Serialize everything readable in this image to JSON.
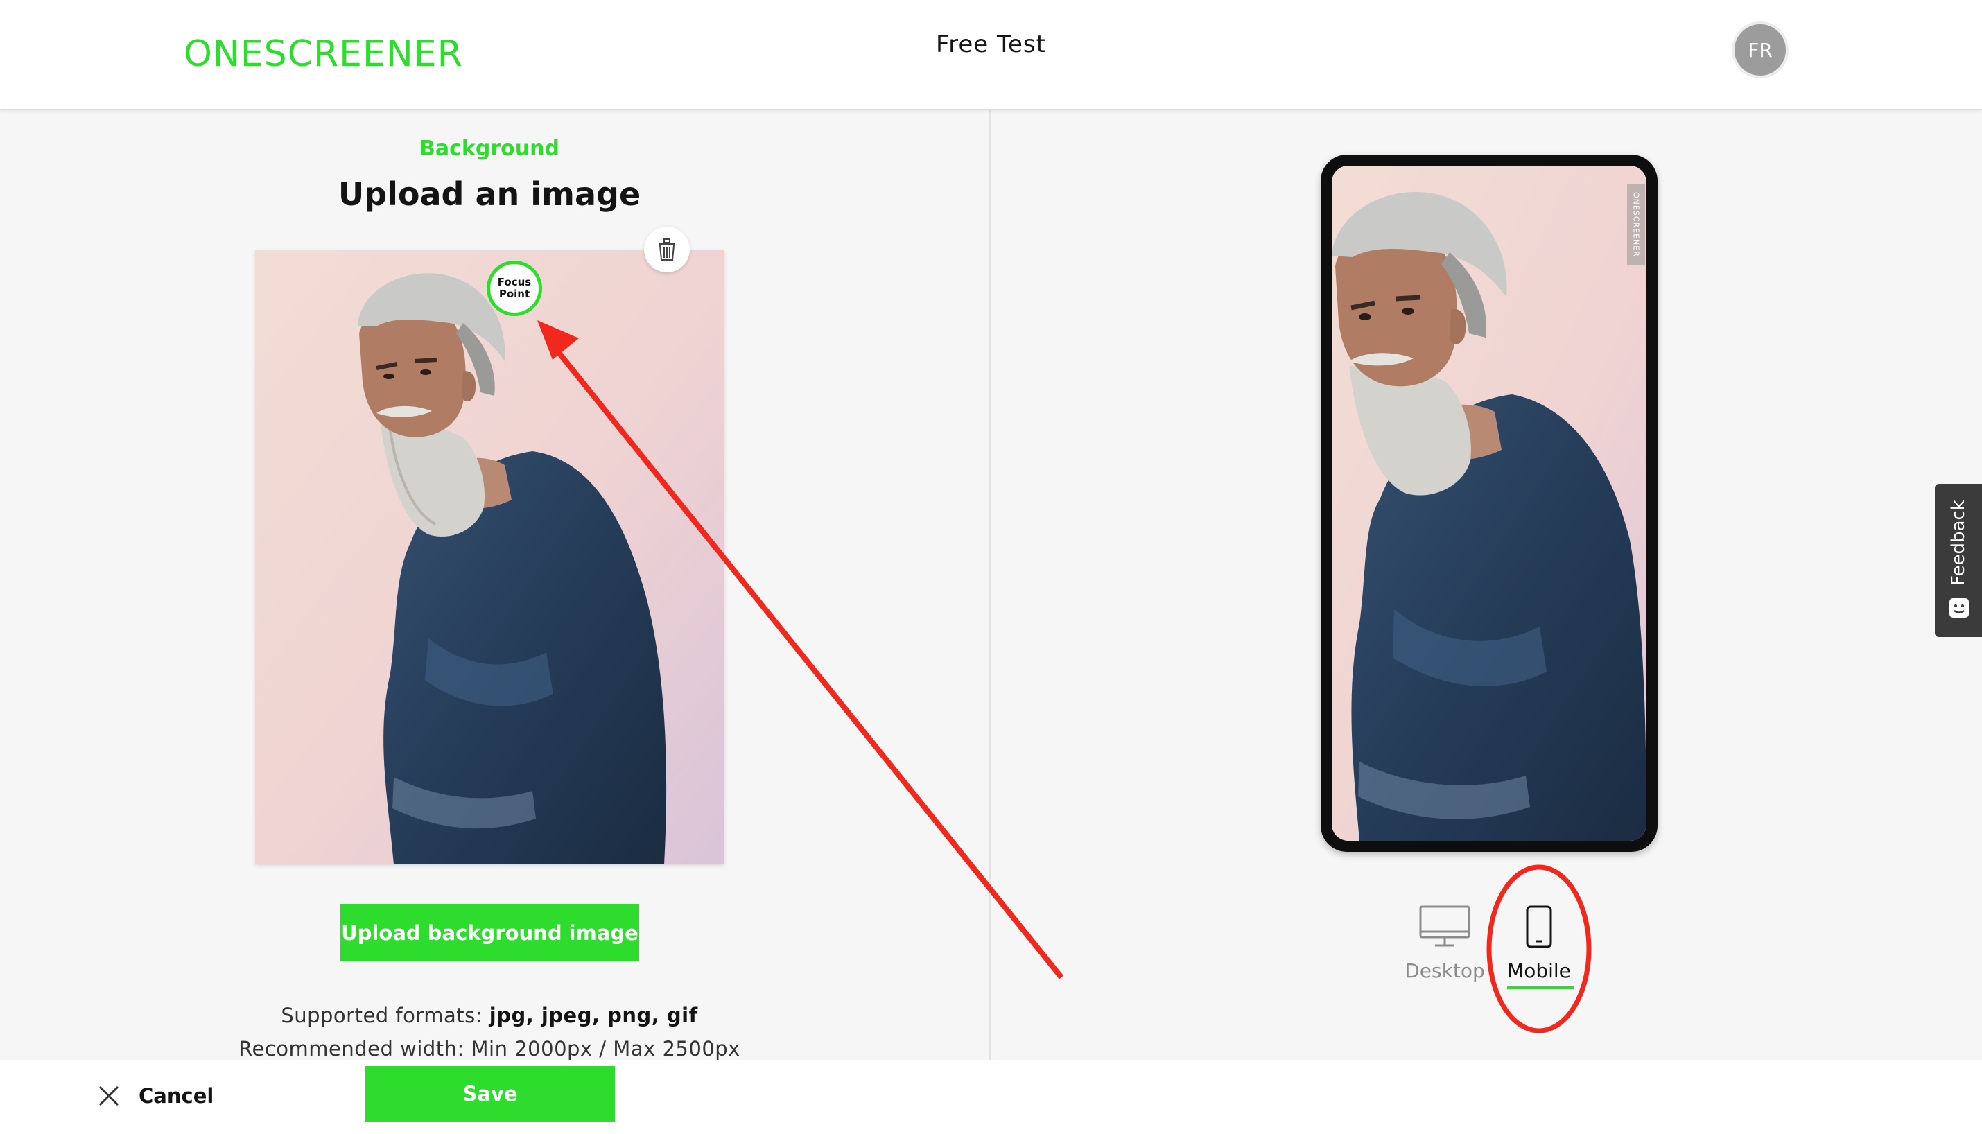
{
  "header": {
    "logo": "ONESCREENER",
    "project_title": "Free Test",
    "avatar_initials": "FR"
  },
  "editor": {
    "section_label": "Background",
    "section_title": "Upload an image",
    "focus_point_label_line1": "Focus",
    "focus_point_label_line2": "Point",
    "upload_button_label": "Upload background image",
    "formats_prefix": "Supported formats: ",
    "formats_value": "jpg, jpeg, png, gif",
    "recommended_width": "Recommended width: Min 2000px / Max 2500px"
  },
  "preview": {
    "watermark": "ONESCREENER",
    "devices": [
      {
        "label": "Desktop",
        "icon": "desktop-icon",
        "selected": false
      },
      {
        "label": "Mobile",
        "icon": "mobile-phone-icon",
        "selected": true
      }
    ]
  },
  "footer": {
    "cancel_label": "Cancel",
    "save_label": "Save"
  },
  "feedback": {
    "label": "Feedback"
  },
  "colors": {
    "brand_green": "#2edc2e",
    "annotation_red": "#f0281e",
    "panel_background": "#f6f6f6",
    "avatar_gray": "#9c9c9c"
  }
}
